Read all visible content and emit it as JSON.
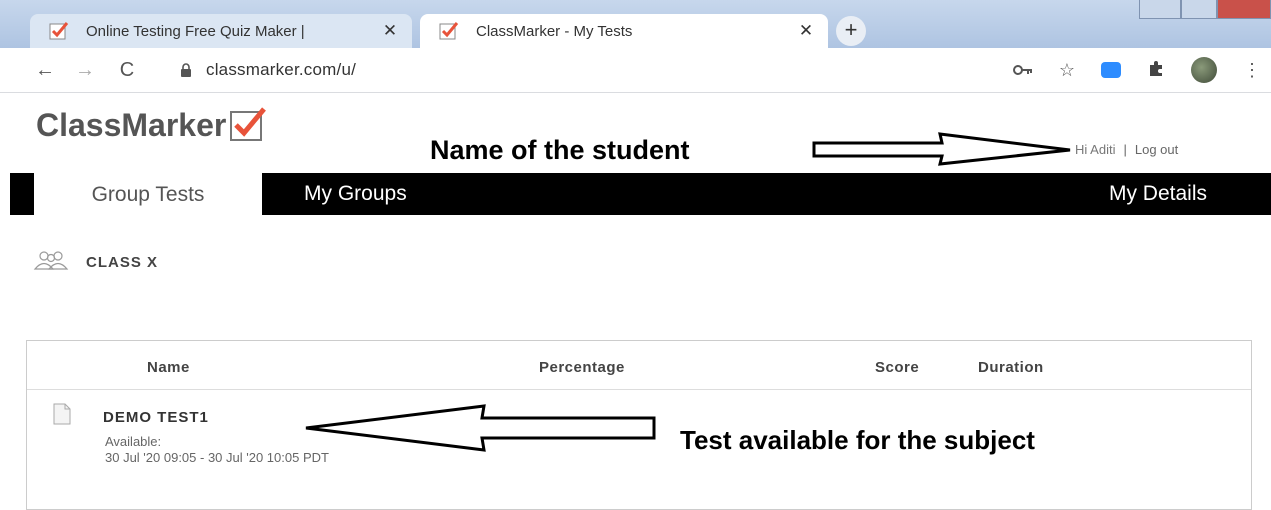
{
  "browser": {
    "tabs": [
      {
        "title": "Online Testing Free Quiz Maker |",
        "active": false,
        "close": "✕"
      },
      {
        "title": "ClassMarker - My Tests",
        "active": true,
        "close": "✕"
      }
    ],
    "new_tab": "+",
    "url": "classmarker.com/u/",
    "icons": [
      "back-icon",
      "forward-icon",
      "reload-icon",
      "lock-icon",
      "key-icon",
      "star-icon",
      "zoom-extension-icon",
      "puzzle-icon",
      "avatar",
      "menu-icon"
    ]
  },
  "site": {
    "logo": "ClassMarker",
    "greeting": "Hi Aditi",
    "separator": "|",
    "logout": "Log out",
    "nav": {
      "group_tests": "Group Tests",
      "my_groups": "My Groups",
      "my_details": "My Details"
    },
    "group_name": "CLASS X",
    "table": {
      "headers": [
        "Name",
        "Percentage",
        "Score",
        "Duration"
      ],
      "rows": [
        {
          "name": "DEMO TEST1",
          "availability_label": "Available:",
          "availability": "30 Jul '20 09:05 - 30 Jul '20 10:05 PDT"
        }
      ]
    }
  },
  "annotations": {
    "student_name": "Name of the student",
    "test_available": "Test available for the subject"
  },
  "colors": {
    "accent": "#e8533a",
    "nav_bg": "#000000",
    "zoom_blue": "#2d8cff"
  }
}
